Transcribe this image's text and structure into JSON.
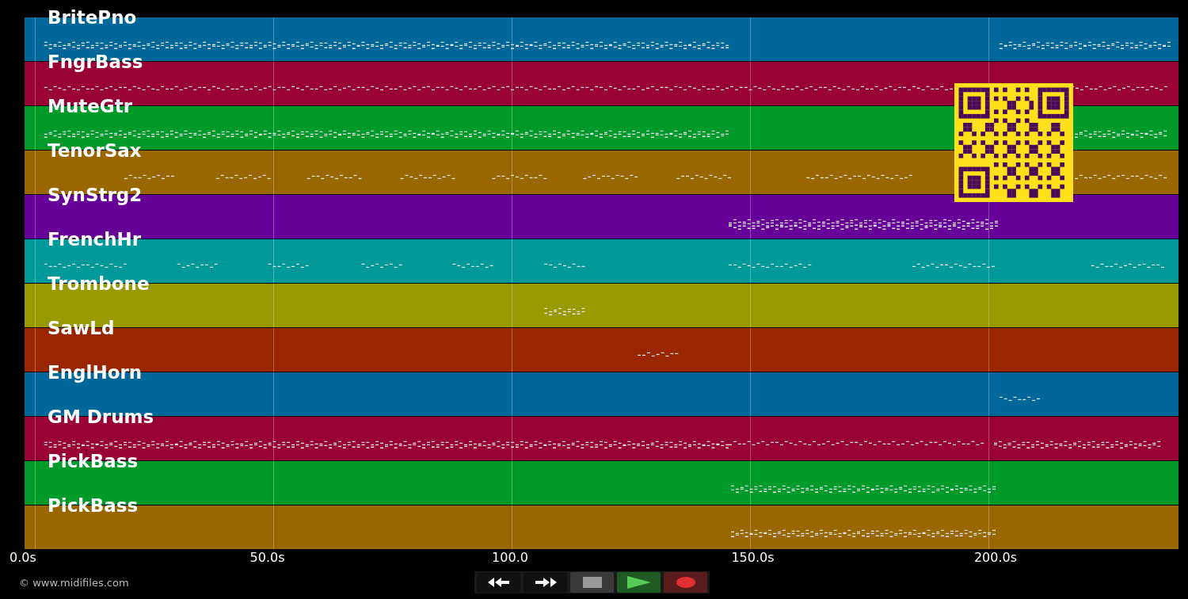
{
  "tracks": [
    {
      "name": "BritePno",
      "color": "#00679b"
    },
    {
      "name": "FngrBass",
      "color": "#990033"
    },
    {
      "name": "MuteGtr",
      "color": "#009a2b"
    },
    {
      "name": "TenorSax",
      "color": "#996600"
    },
    {
      "name": "SynStrg2",
      "color": "#660099"
    },
    {
      "name": "FrenchHr",
      "color": "#009999"
    },
    {
      "name": "Trombone",
      "color": "#999900"
    },
    {
      "name": "SawLd",
      "color": "#992600"
    },
    {
      "name": "EnglHorn",
      "color": "#00679b"
    },
    {
      "name": "GM Drums",
      "color": "#990033"
    },
    {
      "name": "PickBass",
      "color": "#009a2b"
    },
    {
      "name": "PickBass",
      "color": "#996600"
    }
  ],
  "axis": {
    "ticks": [
      "0.0s",
      "50.0s",
      "100.0",
      "150.0s",
      "200.0s"
    ]
  },
  "credit": "© www.midifiles.com",
  "transport": [
    {
      "kind": "rewind"
    },
    {
      "kind": "forward"
    },
    {
      "kind": "stop"
    },
    {
      "kind": "play"
    },
    {
      "kind": "record"
    }
  ]
}
